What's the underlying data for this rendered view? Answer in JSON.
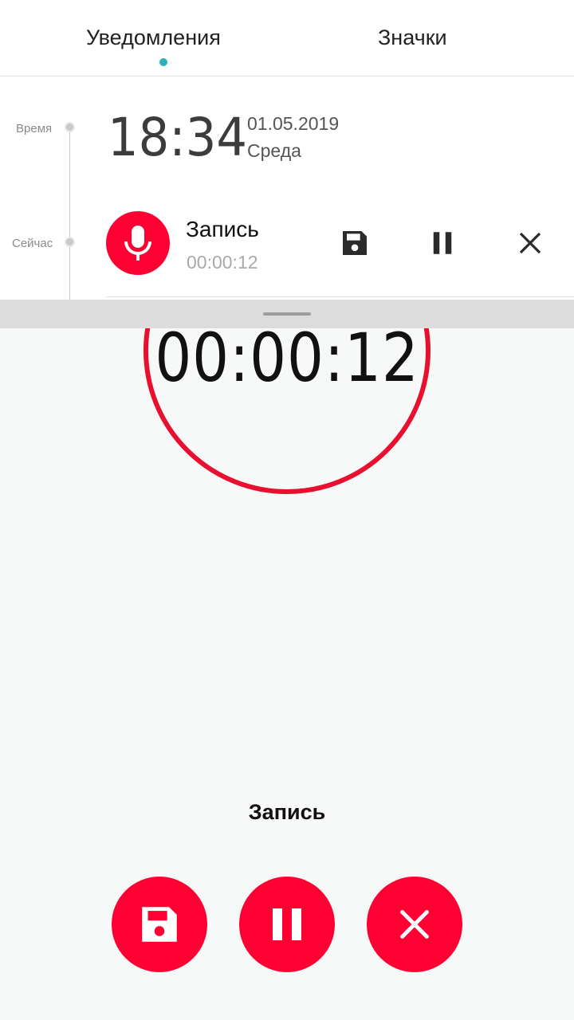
{
  "tabs": {
    "notifications": "Уведомления",
    "icons": "Значки"
  },
  "timeline": {
    "time_label": "Время",
    "now_label": "Сейчас"
  },
  "clock": {
    "time": "18:34",
    "date": "01.05.2019",
    "weekday": "Среда"
  },
  "notification": {
    "icon": "microphone-icon",
    "title": "Запись",
    "elapsed": "00:00:12",
    "actions": [
      "save-icon",
      "pause-icon",
      "close-icon"
    ]
  },
  "recorder": {
    "timer": "00:00:12",
    "status": "Запись",
    "buttons": [
      "save-icon",
      "pause-icon",
      "close-icon"
    ]
  },
  "colors": {
    "accent": "#ff0033",
    "ring": "#e8102f",
    "tab_indicator": "#2bb3bc"
  }
}
